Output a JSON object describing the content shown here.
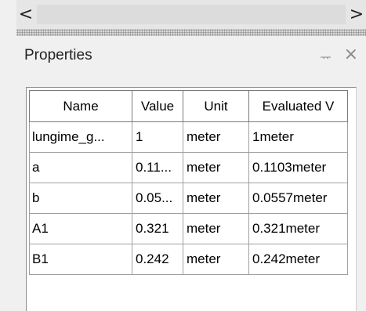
{
  "scrollbar": {
    "left_arrow": "<",
    "right_arrow": ">"
  },
  "panel": {
    "title": "Properties",
    "pin_icon": "pin-icon",
    "close_icon": "close-icon"
  },
  "table": {
    "columns": [
      "Name",
      "Value",
      "Unit",
      "Evaluated V"
    ],
    "rows": [
      {
        "name": "lungime_g...",
        "value": "1",
        "unit": "meter",
        "evaluated": "1meter"
      },
      {
        "name": "a",
        "value": "0.11...",
        "unit": "meter",
        "evaluated": "0.1103meter"
      },
      {
        "name": "b",
        "value": "0.05...",
        "unit": "meter",
        "evaluated": "0.0557meter"
      },
      {
        "name": "A1",
        "value": "0.321",
        "unit": "meter",
        "evaluated": "0.321meter"
      },
      {
        "name": "B1",
        "value": "0.242",
        "unit": "meter",
        "evaluated": "0.242meter"
      }
    ]
  }
}
